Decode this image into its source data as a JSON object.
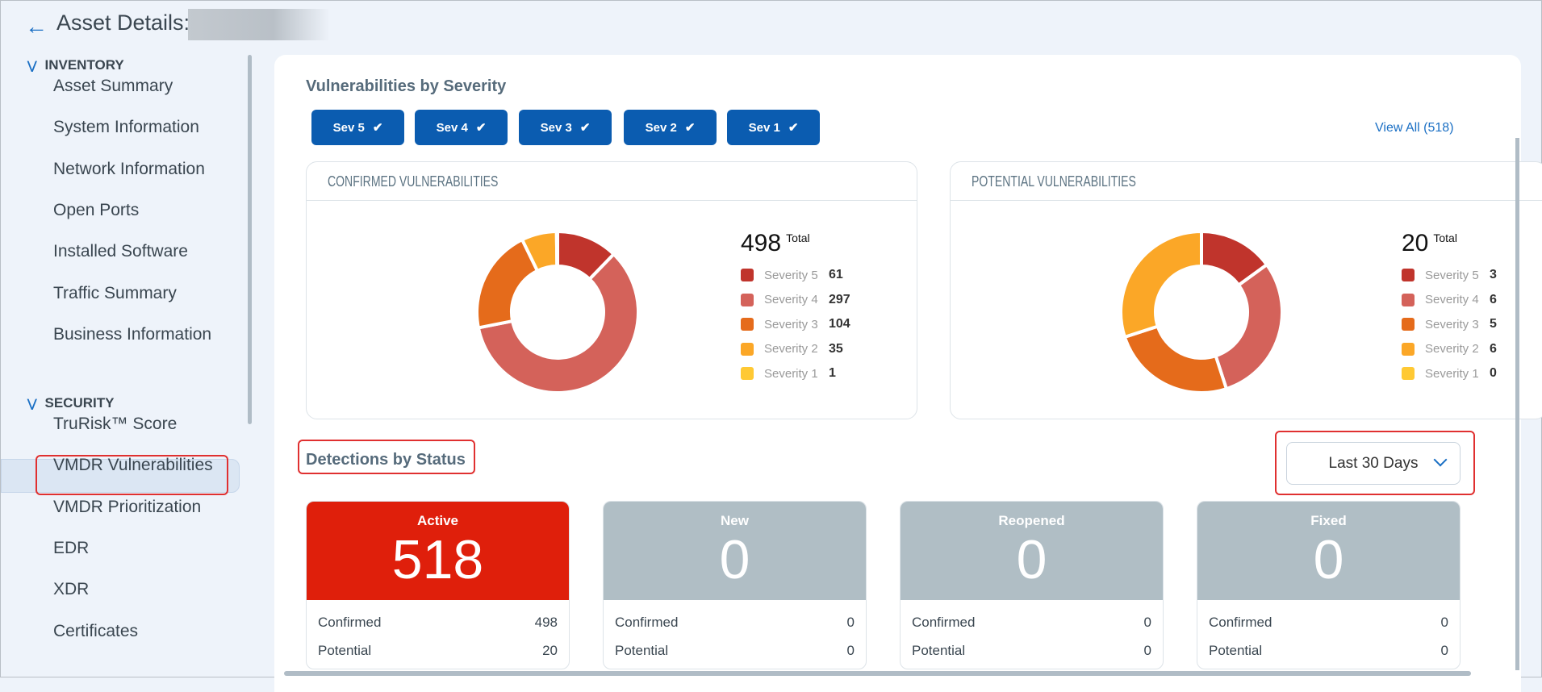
{
  "header": {
    "back_icon": "arrow-left-icon",
    "title": "Asset Details:"
  },
  "sidebar": {
    "inventory": {
      "label": "INVENTORY",
      "items": [
        "Asset Summary",
        "System Information",
        "Network Information",
        "Open Ports",
        "Installed Software",
        "Traffic Summary",
        "Business Information"
      ]
    },
    "security": {
      "label": "SECURITY",
      "items": [
        "TruRisk™ Score",
        "VMDR Vulnerabilities",
        "VMDR Prioritization",
        "EDR",
        "XDR",
        "Certificates"
      ]
    },
    "selected": "VMDR Vulnerabilities"
  },
  "severity": {
    "title": "Vulnerabilities by Severity",
    "filters": [
      "Sev 5",
      "Sev 4",
      "Sev 3",
      "Sev 2",
      "Sev 1"
    ],
    "view_all": "View All (518)"
  },
  "chart_data": [
    {
      "type": "pie",
      "title": "CONFIRMED VULNERABILITIES",
      "total": "498",
      "total_label": "Total",
      "categories": [
        "Severity 5",
        "Severity 4",
        "Severity 3",
        "Severity 2",
        "Severity 1"
      ],
      "values": [
        61,
        297,
        104,
        35,
        1
      ],
      "colors": [
        "#c0342c",
        "#d4625a",
        "#e56b1b",
        "#fba727",
        "#ffc934"
      ]
    },
    {
      "type": "pie",
      "title": "POTENTIAL VULNERABILITIES",
      "total": "20",
      "total_label": "Total",
      "categories": [
        "Severity 5",
        "Severity 4",
        "Severity 3",
        "Severity 2",
        "Severity 1"
      ],
      "values": [
        3,
        6,
        5,
        6,
        0
      ],
      "colors": [
        "#c0342c",
        "#d4625a",
        "#e56b1b",
        "#fba727",
        "#ffc934"
      ]
    }
  ],
  "detections": {
    "title": "Detections by Status",
    "range": "Last 30 Days",
    "confirmed_label": "Confirmed",
    "potential_label": "Potential",
    "cards": [
      {
        "label": "Active",
        "value": "518",
        "confirmed": "498",
        "potential": "20",
        "color": "#df1f0b"
      },
      {
        "label": "New",
        "value": "0",
        "confirmed": "0",
        "potential": "0",
        "color": "#b0bec5"
      },
      {
        "label": "Reopened",
        "value": "0",
        "confirmed": "0",
        "potential": "0",
        "color": "#b0bec5"
      },
      {
        "label": "Fixed",
        "value": "0",
        "confirmed": "0",
        "potential": "0",
        "color": "#b0bec5"
      }
    ]
  }
}
